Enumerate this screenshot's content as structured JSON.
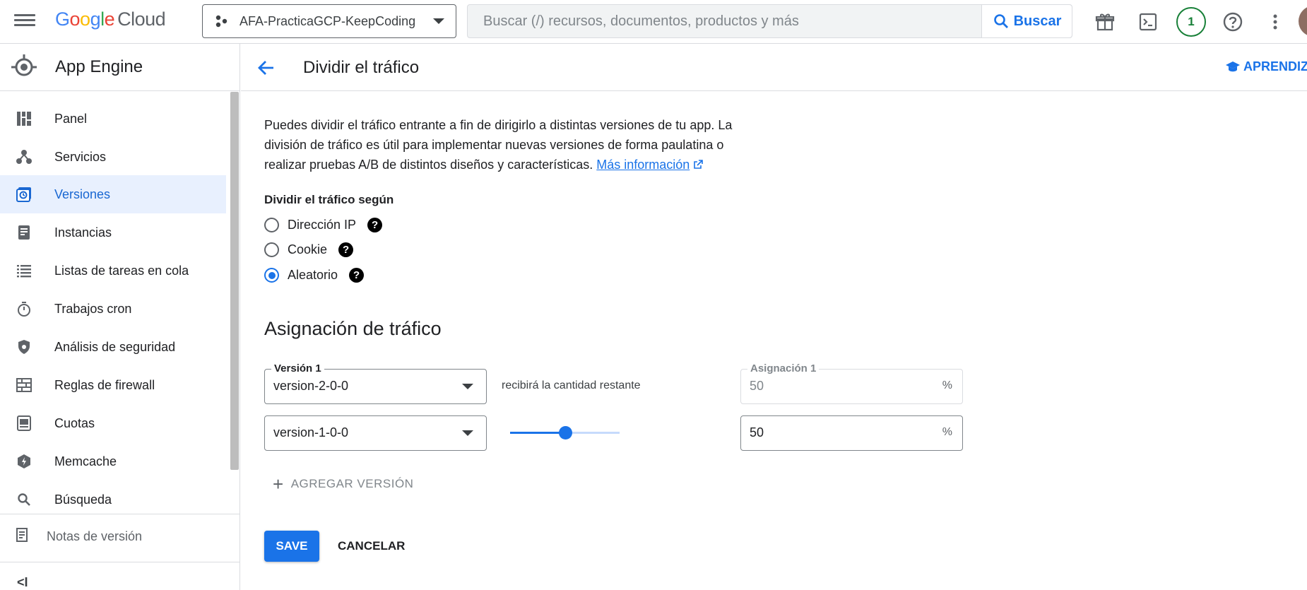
{
  "topbar": {
    "logo_text": "Google",
    "logo_suffix": "Cloud",
    "project_name": "AFA-PracticaGCP-KeepCoding",
    "search_placeholder": "Buscar (/) recursos, documentos, productos y más",
    "search_button": "Buscar",
    "notification_count": "1",
    "icons": [
      "menu-icon",
      "project-icon",
      "search-icon",
      "gift-icon",
      "terminal-icon",
      "help-icon",
      "more-vert-icon"
    ]
  },
  "sidebar": {
    "product": "App Engine",
    "items": [
      {
        "label": "Panel",
        "icon": "dashboard-icon",
        "active": false
      },
      {
        "label": "Servicios",
        "icon": "services-icon",
        "active": false
      },
      {
        "label": "Versiones",
        "icon": "versions-icon",
        "active": true
      },
      {
        "label": "Instancias",
        "icon": "instances-icon",
        "active": false
      },
      {
        "label": "Listas de tareas en cola",
        "icon": "list-icon",
        "active": false
      },
      {
        "label": "Trabajos cron",
        "icon": "timer-icon",
        "active": false
      },
      {
        "label": "Análisis de seguridad",
        "icon": "shield-icon",
        "active": false
      },
      {
        "label": "Reglas de firewall",
        "icon": "firewall-icon",
        "active": false
      },
      {
        "label": "Cuotas",
        "icon": "quota-icon",
        "active": false
      },
      {
        "label": "Memcache",
        "icon": "memcache-icon",
        "active": false
      },
      {
        "label": "Búsqueda",
        "icon": "search-icon",
        "active": false
      }
    ],
    "release_notes": "Notas de versión",
    "collapse_label": "<I"
  },
  "main": {
    "title": "Dividir el tráfico",
    "learn_label": "APRENDIZA",
    "description": "Puedes dividir el tráfico entrante a fin de dirigirlo a distintas versiones de tu app. La división de tráfico es útil para implementar nuevas versiones de forma paulatina o realizar pruebas A/B de distintos diseños y características.",
    "more_info": "Más información",
    "split_label": "Dividir el tráfico según",
    "split_options": [
      {
        "label": "Dirección IP",
        "checked": false
      },
      {
        "label": "Cookie",
        "checked": false
      },
      {
        "label": "Aleatorio",
        "checked": true
      }
    ],
    "allocation_title": "Asignación de tráfico",
    "version_label": "Versión 1",
    "version1_value": "version-2-0-0",
    "remaining_text": "recibirá la cantidad restante",
    "allocation_label": "Asignación 1",
    "allocation1_value": "50",
    "version2_value": "version-1-0-0",
    "allocation2_value": "50",
    "slider_percent": 50,
    "percent_symbol": "%",
    "add_version": "AGREGAR VERSIÓN",
    "save_label": "SAVE",
    "cancel_label": "CANCELAR"
  },
  "colors": {
    "accent": "#1a73e8",
    "active_bg": "#e8f0fe",
    "badge_green": "#188038"
  }
}
